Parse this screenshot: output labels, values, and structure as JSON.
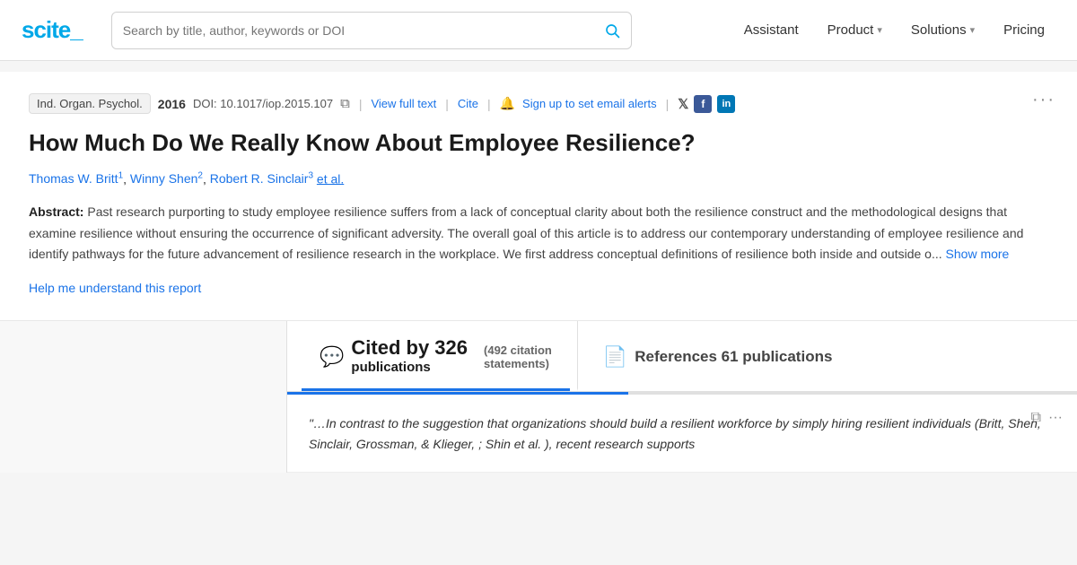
{
  "logo": {
    "text": "scite_",
    "brand": "scite",
    "underscore": "_"
  },
  "search": {
    "placeholder": "Search by title, author, keywords or DOI",
    "value": ""
  },
  "nav": {
    "assistant": "Assistant",
    "product": "Product",
    "solutions": "Solutions",
    "pricing": "Pricing"
  },
  "paper": {
    "journal": "Ind. Organ. Psychol.",
    "year": "2016",
    "doi_label": "DOI:",
    "doi": "10.1017/iop.2015.107",
    "view_full_text": "View full text",
    "cite": "Cite",
    "sign_up_text": "Sign up to set email alerts",
    "more_label": "···",
    "title": "How Much Do We Really Know About Employee Resilience?",
    "authors": [
      {
        "name": "Thomas W. Britt",
        "superscript": "1"
      },
      {
        "name": "Winny Shen",
        "superscript": "2"
      },
      {
        "name": "Robert R. Sinclair",
        "superscript": "3"
      }
    ],
    "et_al": "et al.",
    "abstract_label": "Abstract:",
    "abstract_text": "Past research purporting to study employee resilience suffers from a lack of conceptual clarity about both the resilience construct and the methodological designs that examine resilience without ensuring the occurrence of significant adversity. The overall goal of this article is to address our contemporary understanding of employee resilience and identify pathways for the future advancement of resilience research in the workplace. We first address conceptual definitions of resilience both inside and outside o...",
    "show_more": "Show more",
    "help_link": "Help me understand this report"
  },
  "citations": {
    "cited_by_count": "326",
    "cited_by_label": "Cited by 326",
    "cited_by_line1": "Cited by 326",
    "cited_by_line2": "publications",
    "citation_statements": "(492 citation",
    "citation_statements2": "statements)",
    "references_label": "References 61 publications",
    "references_count": "61",
    "active_tab": "cited_by"
  },
  "quote": {
    "text": "\"…In contrast to the suggestion that organizations should build a resilient workforce by simply hiring resilient individuals (Britt, Shen, Sinclair, Grossman, & Klieger, ; Shin et al. ), recent research supports"
  },
  "icons": {
    "search": "🔍",
    "copy": "⧉",
    "bell": "🔔",
    "twitter": "𝕏",
    "facebook": "f",
    "linkedin": "in",
    "chat_bubble": "💬",
    "document": "📄",
    "copy_small": "⧉",
    "more": "···"
  }
}
